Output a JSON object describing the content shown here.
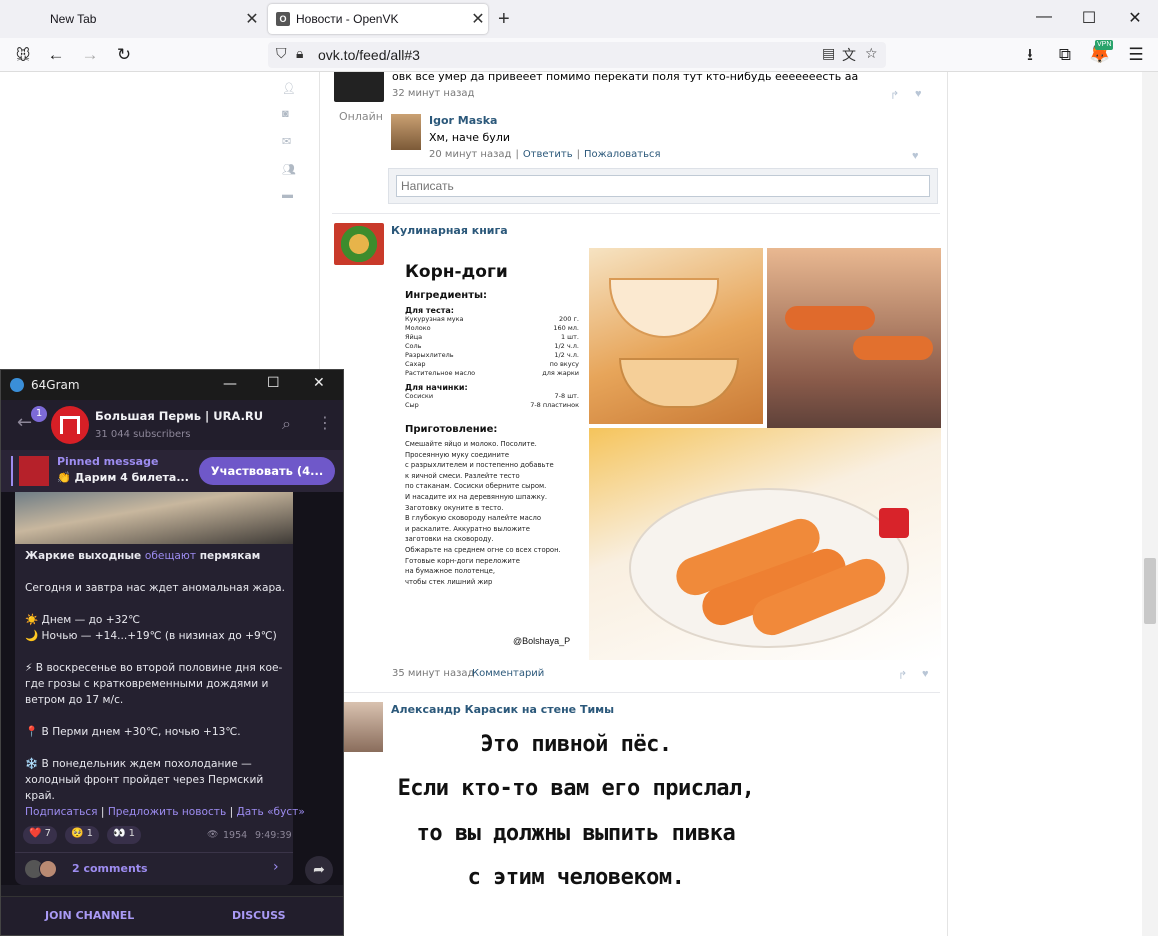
{
  "browser": {
    "tabs": [
      {
        "title": "New Tab"
      },
      {
        "title": "Новости - OpenVK"
      }
    ],
    "url": "ovk.to/feed/all#3",
    "vpn_badge": "VPN"
  },
  "sidebar": {
    "online_label": "Онлайн"
  },
  "feed": {
    "prev_post": {
      "text": "овк все умер да привееет помимо перекати поля тут кто-нибудь ееееееесть аа",
      "time": "32 минут назад"
    },
    "comment": {
      "author": "Igor Maska",
      "text": "Хм, наче були",
      "time": "20 минут назад",
      "reply": "Ответить",
      "report": "Пожаловаться",
      "input_placeholder": "Написать"
    },
    "post1": {
      "author": "Кулинарная книга",
      "time": "35 минут назад",
      "comment_link": "Комментарий",
      "recipe": {
        "title": "Корн-доги",
        "ingredients_h": "Ингредиенты:",
        "dough_h": "Для теста:",
        "dough": [
          [
            "Кукурузная мука",
            "200 г."
          ],
          [
            "Молоко",
            "160 мл."
          ],
          [
            "Яйца",
            "1 шт."
          ],
          [
            "Соль",
            "1/2 ч.л."
          ],
          [
            "Разрыхлитель",
            "1/2 ч.л."
          ],
          [
            "Сахар",
            "по вкусу"
          ],
          [
            "Растительное масло",
            "для жарки"
          ]
        ],
        "filling_h": "Для начинки:",
        "filling": [
          [
            "Сосиски",
            "7-8 шт."
          ],
          [
            "Сыр",
            "7-8 пластинок"
          ]
        ],
        "method_h": "Приготовление:",
        "method": "Смешайте яйцо и молоко. Посолите.\nПросеянную муку соедините\nс разрыхлителем и постепенно добавьте\nк яичной смеси. Разлейте тесто\nпо стаканам. Сосиски оберните сыром.\nИ насадите их на деревянную шпажку.\nЗаготовку окуните в тесто.\nВ глубокую сковороду налейте масло\nи раскалите. Аккуратно выложите\nзаготовки на сковороду.\nОбжарьте на среднем огне со всех сторон.\nГотовые корн-доги переложите\nна бумажное полотенце,\nчтобы стек лишний жир",
        "signature": "@Bolshaya_P"
      }
    },
    "post2": {
      "author": "Александр Карасик на стене Тимы",
      "meme_lines": [
        "Это пивной пёс.",
        "Если кто-то вам его прислал,",
        "то вы должны выпить пивка",
        "с этим человеком."
      ]
    }
  },
  "telegram": {
    "app_title": "64Gram",
    "unread_badge": "1",
    "channel_name": "Большая Пермь | URA.RU",
    "subscribers": "31 044 subscribers",
    "pinned_label": "Pinned message",
    "pinned_text": "👏 Дарим 4 билета...",
    "pinned_button": "Участвовать (4...",
    "headline_1": "Жаркие выходные ",
    "headline_link": "обещают",
    "headline_2": " пермякам",
    "p1": "Сегодня и завтра нас ждет аномальная жара.",
    "p2a": "☀️ Днем — до +32℃",
    "p2b": "🌙 Ночью — +14...+19℃ (в низинах до +9℃)",
    "p3": "⚡ В воскресенье во второй половине дня кое-где грозы с кратковременными дождями и ветром до 17 м/с.",
    "p4": "📍 В Перми днем +30℃, ночью +13℃.",
    "p5": "❄️ В понедельник ждем похолодание — холодный фронт пройдет через Пермский край.",
    "link1": "Подписаться",
    "link2": "Предложить новость",
    "link3": "Дать «буст»",
    "reactions": [
      {
        "emoji": "❤️",
        "count": "7"
      },
      {
        "emoji": "🥺",
        "count": "1"
      },
      {
        "emoji": "👀",
        "count": "1"
      }
    ],
    "views": "1954",
    "time": "9:49:39",
    "comments": "2 comments",
    "join": "JOIN CHANNEL",
    "discuss": "DISCUSS"
  }
}
